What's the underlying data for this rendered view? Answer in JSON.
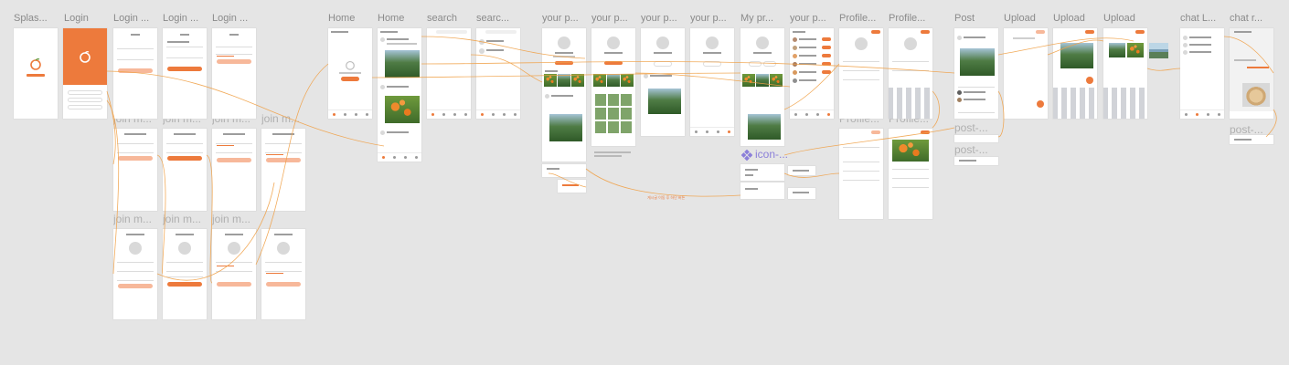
{
  "canvas": {
    "background": "#e5e5e5",
    "accent": "#ed7a3c",
    "accent_light": "#f7b89a",
    "connector_color": "#f0a24a"
  },
  "labels": {
    "splash": "Splas...",
    "login": "Login",
    "login_email_1": "Login ...",
    "login_email_2": "Login ...",
    "login_email_3": "Login ...",
    "join_1": "join m...",
    "join_2": "join m...",
    "join_3": "join m...",
    "join_4": "join m...",
    "join_5": "join m...",
    "join_6": "join m...",
    "join_7": "join m...",
    "home_empty": "Home",
    "home_feed": "Home",
    "search": "search",
    "search_results": "searc...",
    "your_profile_1": "your p...",
    "your_profile_2": "your p...",
    "your_profile_3": "your p...",
    "your_profile_4": "your p...",
    "my_profile": "My pr...",
    "your_profile_5": "your p...",
    "profile_1": "Profile...",
    "profile_2": "Profile...",
    "profile_3": "Profile...",
    "profile_4": "Profile...",
    "post": "Post",
    "post_2": "post-...",
    "post_3": "post-...",
    "post_4": "post-...",
    "upload_1": "Upload",
    "upload_2": "Upload",
    "upload_3": "Upload",
    "chat_list": "chat L...",
    "chat_room": "chat r...",
    "icon_component": "icon-..."
  },
  "icons": {
    "logo": "tangerine-logo-icon",
    "component": "four-diamond-component-icon"
  },
  "annotations": {
    "flow_note": "게시글 이동 후 하단 버튼"
  }
}
